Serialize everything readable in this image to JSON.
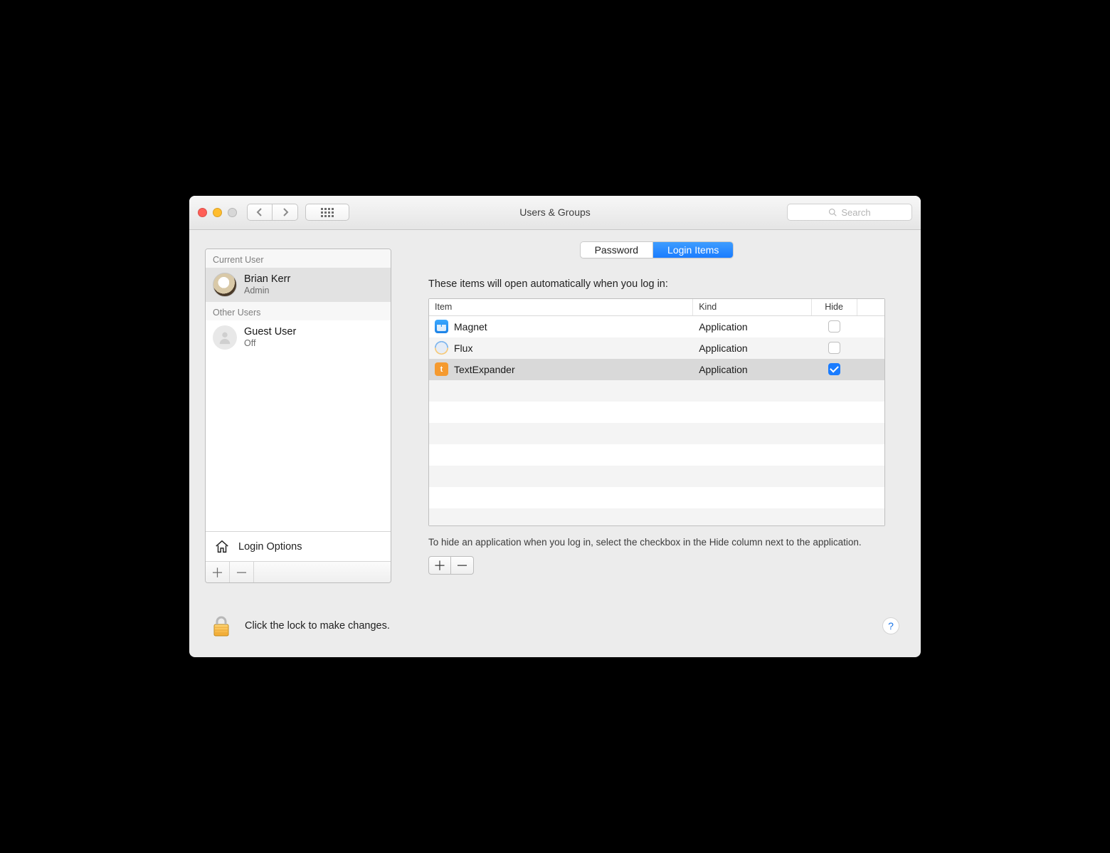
{
  "window": {
    "title": "Users & Groups"
  },
  "toolbar": {
    "search_placeholder": "Search"
  },
  "sidebar": {
    "current_label": "Current User",
    "other_label": "Other Users",
    "login_options_label": "Login Options",
    "current_user": {
      "name": "Brian Kerr",
      "role": "Admin"
    },
    "other_users": [
      {
        "name": "Guest User",
        "status": "Off"
      }
    ]
  },
  "tabs": {
    "password": "Password",
    "login_items": "Login Items",
    "active": "login_items"
  },
  "main": {
    "intro": "These items will open automatically when you log in:",
    "columns": {
      "item": "Item",
      "kind": "Kind",
      "hide": "Hide"
    },
    "hint": "To hide an application when you log in, select the checkbox in the Hide column next to the application.",
    "rows": [
      {
        "name": "Magnet",
        "kind": "Application",
        "hide": false,
        "icon": "magnet",
        "selected": false
      },
      {
        "name": "Flux",
        "kind": "Application",
        "hide": false,
        "icon": "flux",
        "selected": false
      },
      {
        "name": "TextExpander",
        "kind": "Application",
        "hide": true,
        "icon": "textexpander",
        "selected": true
      }
    ]
  },
  "footer": {
    "lock_text": "Click the lock to make changes.",
    "help": "?"
  }
}
